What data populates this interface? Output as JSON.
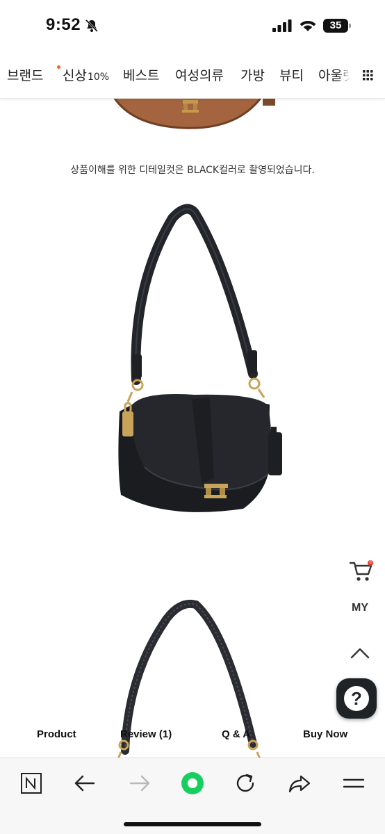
{
  "status_bar": {
    "time": "9:52",
    "battery": "35",
    "icons": [
      "bell-slash-icon",
      "cellular-signal-icon",
      "wifi-icon",
      "battery-icon"
    ]
  },
  "category_nav": {
    "items": [
      {
        "label": "브랜드"
      },
      {
        "label": "신상",
        "badge": "10%"
      },
      {
        "label": "베스트"
      },
      {
        "label": "여성의류"
      },
      {
        "label": "가방"
      },
      {
        "label": "뷰티"
      },
      {
        "label": "아울렛"
      }
    ],
    "new_dot_color": "#f26a1b",
    "menu_icon": "grid-menu-icon"
  },
  "content": {
    "detail_note": "상품이해를 위한 디테일컷은 BLACK컬러로 촬영되었습니다.",
    "images": [
      "brown-bag-image",
      "black-shoulder-bag-image",
      "black-bag-strap-image"
    ]
  },
  "floating": {
    "cart_count": "0",
    "my_label": "MY",
    "help_label": "?"
  },
  "product_tabs": {
    "product": "Product",
    "review": "Review (1)",
    "qa": "Q & A",
    "buy_now": "Buy Now"
  },
  "browser_toolbar": {
    "buttons": [
      "naver-home-icon",
      "back-arrow-icon",
      "forward-arrow-icon",
      "green-action-icon",
      "reload-icon",
      "share-icon",
      "hamburger-menu-icon"
    ],
    "accent": "#19ce60"
  }
}
